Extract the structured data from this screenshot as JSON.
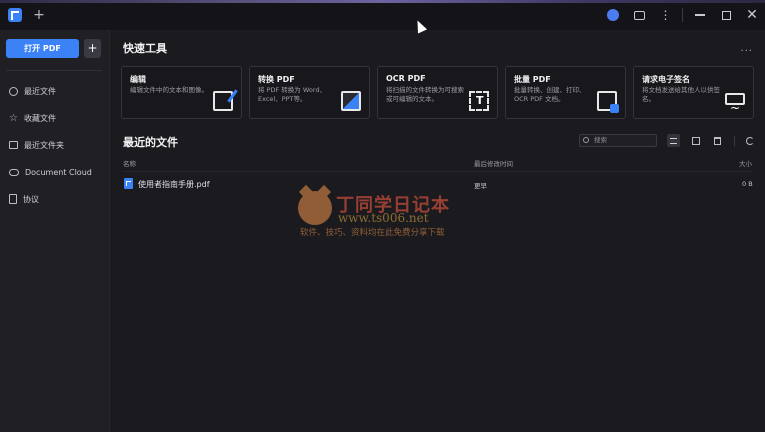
{
  "titlebar": {
    "new_tab_symbol": "+",
    "close_symbol": "✕"
  },
  "sidebar": {
    "open_pdf_label": "打开 PDF",
    "add_symbol": "+",
    "items": [
      {
        "label": "最近文件",
        "icon": "clock-icon"
      },
      {
        "label": "收藏文件",
        "icon": "star-icon"
      },
      {
        "label": "最近文件夹",
        "icon": "folder-icon"
      },
      {
        "label": "Document Cloud",
        "icon": "cloud-icon"
      },
      {
        "label": "协议",
        "icon": "document-icon"
      }
    ]
  },
  "quick_tools": {
    "title": "快速工具",
    "more_symbol": "...",
    "cards": [
      {
        "title": "编辑",
        "desc": "编辑文件中的文本和图像。",
        "icon": "edit-icon"
      },
      {
        "title": "转换 PDF",
        "desc": "将 PDF 转换为 Word、Excel、PPT等。",
        "icon": "convert-icon"
      },
      {
        "title": "OCR PDF",
        "desc": "将扫描的文件转换为可搜索或可编辑的文本。",
        "icon": "ocr-icon"
      },
      {
        "title": "批量 PDF",
        "desc": "批量转换、创建、打印、OCR PDF 文档。",
        "icon": "batch-icon"
      },
      {
        "title": "请求电子签名",
        "desc": "将文档发送给其他人以供签名。",
        "icon": "signature-icon"
      }
    ]
  },
  "recent_files": {
    "title": "最近的文件",
    "search_placeholder": "搜索",
    "columns": {
      "name": "名称",
      "modified": "最后修改时间",
      "size": "大小"
    },
    "rows": [
      {
        "name": "使用者指南手册.pdf",
        "modified": "更早",
        "size": "0 B"
      }
    ]
  },
  "watermark": {
    "title": "丁同学日记本",
    "url": "www.ts006.net",
    "subtitle": "软件、技巧、资料均在此免费分享下载"
  },
  "colors": {
    "accent": "#3b82f6",
    "background": "#1b1b1f",
    "sidebar": "#1f1f24",
    "card_border": "#34343b"
  }
}
